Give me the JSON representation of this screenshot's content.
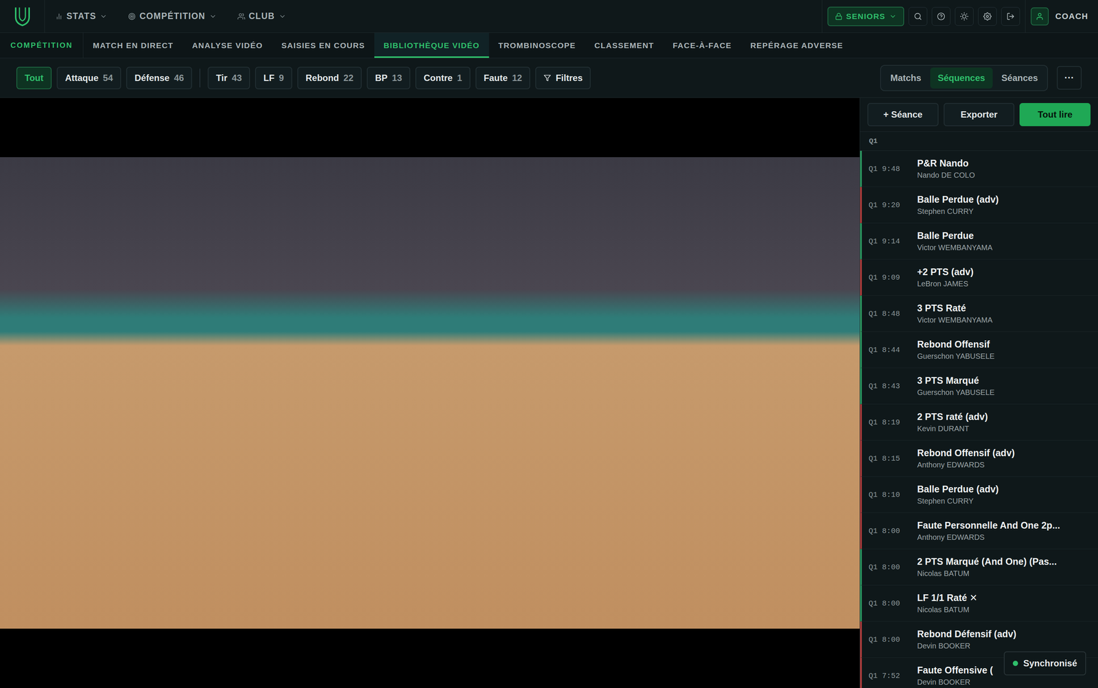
{
  "top_nav": {
    "items": [
      {
        "label": "STATS"
      },
      {
        "label": "COMPÉTITION"
      },
      {
        "label": "CLUB"
      }
    ],
    "team_selector": "SENIORS",
    "user": "COACH"
  },
  "sub_nav": {
    "section": "COMPÉTITION",
    "tabs": [
      {
        "label": "MATCH EN DIRECT",
        "selected": false
      },
      {
        "label": "ANALYSE VIDÉO",
        "selected": false
      },
      {
        "label": "SAISIES EN COURS",
        "selected": false
      },
      {
        "label": "BIBLIOTHÈQUE VIDÉO",
        "selected": true
      },
      {
        "label": "TROMBINOSCOPE",
        "selected": false
      },
      {
        "label": "CLASSEMENT",
        "selected": false
      },
      {
        "label": "FACE-À-FACE",
        "selected": false
      },
      {
        "label": "REPÉRAGE ADVERSE",
        "selected": false
      }
    ]
  },
  "filters": {
    "categories": [
      {
        "label": "Tout",
        "count": "",
        "selected": true
      },
      {
        "label": "Attaque",
        "count": "54",
        "selected": false
      },
      {
        "label": "Défense",
        "count": "46",
        "selected": false
      }
    ],
    "types": [
      {
        "label": "Tir",
        "count": "43",
        "selected": false
      },
      {
        "label": "LF",
        "count": "9",
        "selected": false
      },
      {
        "label": "Rebond",
        "count": "22",
        "selected": false
      },
      {
        "label": "BP",
        "count": "13",
        "selected": false
      },
      {
        "label": "Contre",
        "count": "1",
        "selected": false
      },
      {
        "label": "Faute",
        "count": "12",
        "selected": false
      }
    ],
    "filter_button": "Filtres",
    "views": [
      {
        "label": "Matchs",
        "selected": false
      },
      {
        "label": "Séquences",
        "selected": true
      },
      {
        "label": "Séances",
        "selected": false
      }
    ],
    "more": "···"
  },
  "panel": {
    "actions": [
      {
        "label": "+ Séance",
        "primary": false
      },
      {
        "label": "Exporter",
        "primary": false
      },
      {
        "label": "Tout lire",
        "primary": true
      }
    ],
    "period": "Q1",
    "sequences": [
      {
        "time": "Q1 9:48",
        "title": "P&R Nando",
        "player": "Nando DE COLO",
        "color": "#2a8f5c"
      },
      {
        "time": "Q1 9:20",
        "title": "Balle Perdue (adv)",
        "player": "Stephen CURRY",
        "color": "#a53a3a"
      },
      {
        "time": "Q1 9:14",
        "title": "Balle Perdue",
        "player": "Victor WEMBANYAMA",
        "color": "#2a8f5c"
      },
      {
        "time": "Q1 9:09",
        "title": "+2 PTS (adv)",
        "player": "LeBron JAMES",
        "color": "#a53a3a"
      },
      {
        "time": "Q1 8:48",
        "title": "3 PTS Raté",
        "player": "Victor WEMBANYAMA",
        "color": "#2a8f5c"
      },
      {
        "time": "Q1 8:44",
        "title": "Rebond Offensif",
        "player": "Guerschon YABUSELE",
        "color": "#2a8f5c"
      },
      {
        "time": "Q1 8:43",
        "title": "3 PTS Marqué",
        "player": "Guerschon YABUSELE",
        "color": "#2a8f5c"
      },
      {
        "time": "Q1 8:19",
        "title": "2 PTS raté (adv)",
        "player": "Kevin DURANT",
        "color": "#a53a3a"
      },
      {
        "time": "Q1 8:15",
        "title": "Rebond Offensif (adv)",
        "player": "Anthony EDWARDS",
        "color": "#a53a3a"
      },
      {
        "time": "Q1 8:10",
        "title": "Balle Perdue (adv)",
        "player": "Stephen CURRY",
        "color": "#a53a3a"
      },
      {
        "time": "Q1 8:00",
        "title": "Faute Personnelle And One 2p...",
        "player": "Anthony EDWARDS",
        "color": "#a53a3a"
      },
      {
        "time": "Q1 8:00",
        "title": "2 PTS Marqué (And One) (Pas...",
        "player": "Nicolas BATUM",
        "color": "#2a8f5c"
      },
      {
        "time": "Q1 8:00",
        "title": "LF 1/1 Raté ✕",
        "player": "Nicolas BATUM",
        "color": "#2a8f5c"
      },
      {
        "time": "Q1 8:00",
        "title": "Rebond Défensif (adv)",
        "player": "Devin BOOKER",
        "color": "#a53a3a"
      },
      {
        "time": "Q1 7:52",
        "title": "Faute Offensive (",
        "player": "Devin BOOKER",
        "color": "#a53a3a"
      }
    ]
  },
  "sync_badge": {
    "label": "Synchronisé"
  }
}
